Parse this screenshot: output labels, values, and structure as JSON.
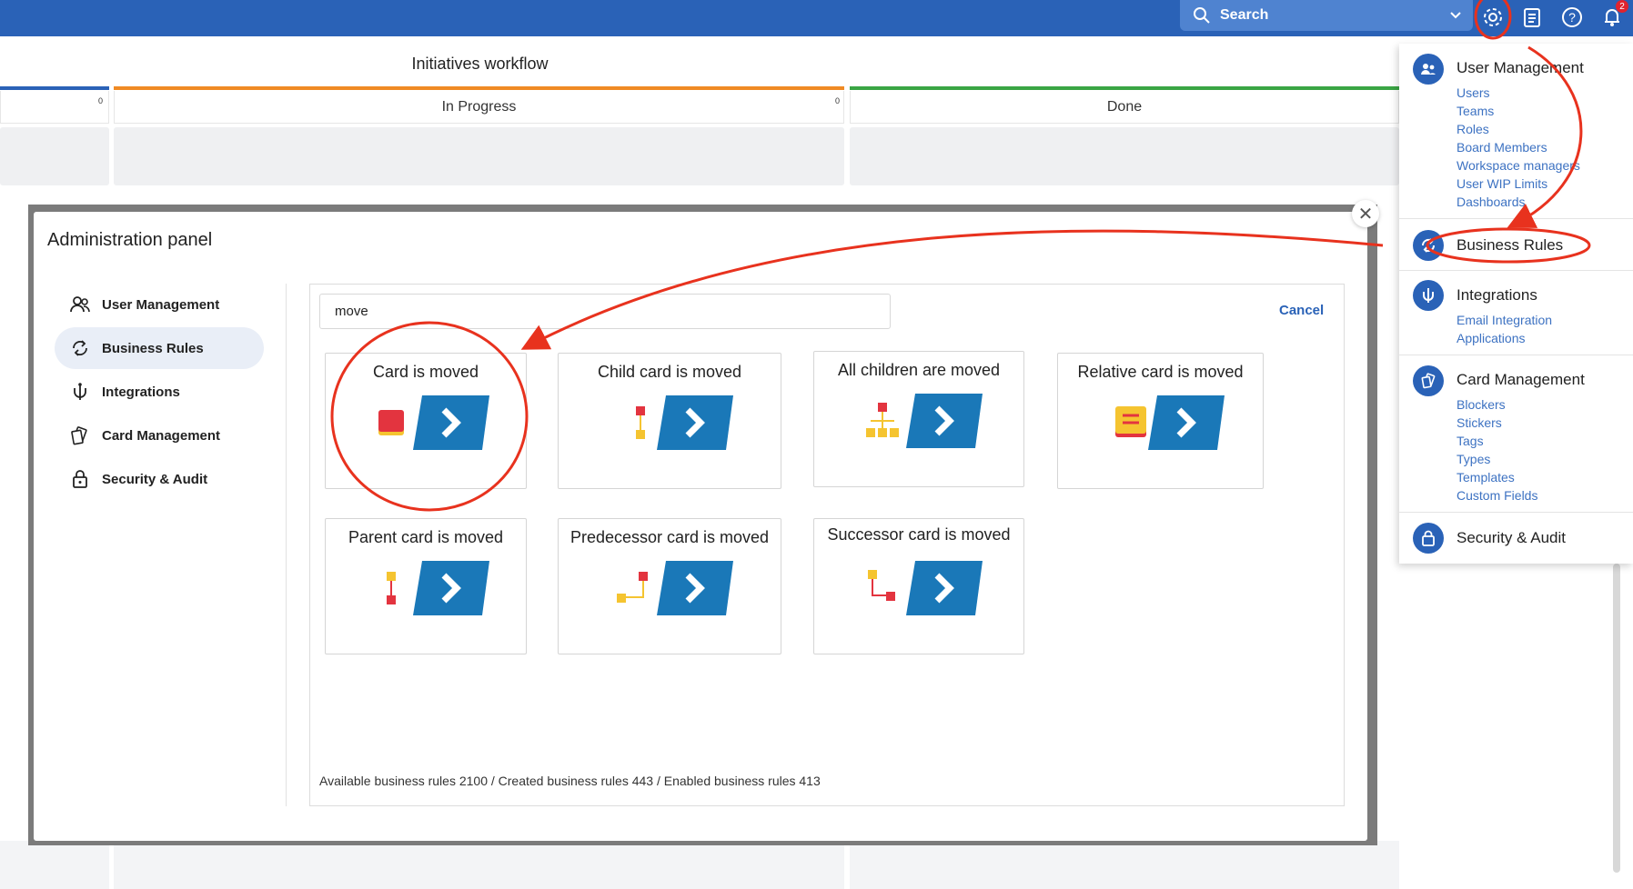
{
  "topbar": {
    "search_label": "Search",
    "notification_count": "2"
  },
  "board": {
    "title": "Initiatives workflow",
    "columns": [
      {
        "name": "",
        "count": "0",
        "color": "#2a62b7"
      },
      {
        "name": "In Progress",
        "count": "0",
        "color": "#f08a24"
      },
      {
        "name": "Done",
        "count": "",
        "color": "#3aa544"
      }
    ]
  },
  "modal": {
    "title": "Administration panel",
    "close_icon": "close-icon",
    "sidebar": [
      {
        "label": "User Management",
        "icon": "users-icon"
      },
      {
        "label": "Business Rules",
        "icon": "refresh-icon",
        "active": true
      },
      {
        "label": "Integrations",
        "icon": "plug-icon"
      },
      {
        "label": "Card Management",
        "icon": "cards-icon"
      },
      {
        "label": "Security & Audit",
        "icon": "lock-icon"
      }
    ],
    "filter_value": "move",
    "cancel_label": "Cancel",
    "rules": [
      {
        "label": "Card is moved"
      },
      {
        "label": "Child card is moved"
      },
      {
        "label": "All children are moved"
      },
      {
        "label": "Relative card is moved"
      },
      {
        "label": "Parent card is moved"
      },
      {
        "label": "Predecessor card is moved"
      },
      {
        "label": "Successor card is moved"
      }
    ],
    "footer": "Available business rules 2100 / Created business rules 443 / Enabled business rules 413"
  },
  "menu": {
    "sections": [
      {
        "title": "User Management",
        "links": [
          "Users",
          "Teams",
          "Roles",
          "Board Members",
          "Workspace managers",
          "User WIP Limits",
          "Dashboards"
        ]
      },
      {
        "title": "Business Rules",
        "links": []
      },
      {
        "title": "Integrations",
        "links": [
          "Email Integration",
          "Applications"
        ]
      },
      {
        "title": "Card Management",
        "links": [
          "Blockers",
          "Stickers",
          "Tags",
          "Types",
          "Templates",
          "Custom Fields"
        ]
      },
      {
        "title": "Security & Audit",
        "links": []
      }
    ]
  },
  "colors": {
    "brand": "#2a62b7",
    "rule_tile": "#1a78b8",
    "annotation": "#e8321e",
    "card_red": "#e3343f",
    "card_yellow": "#f5c430"
  }
}
